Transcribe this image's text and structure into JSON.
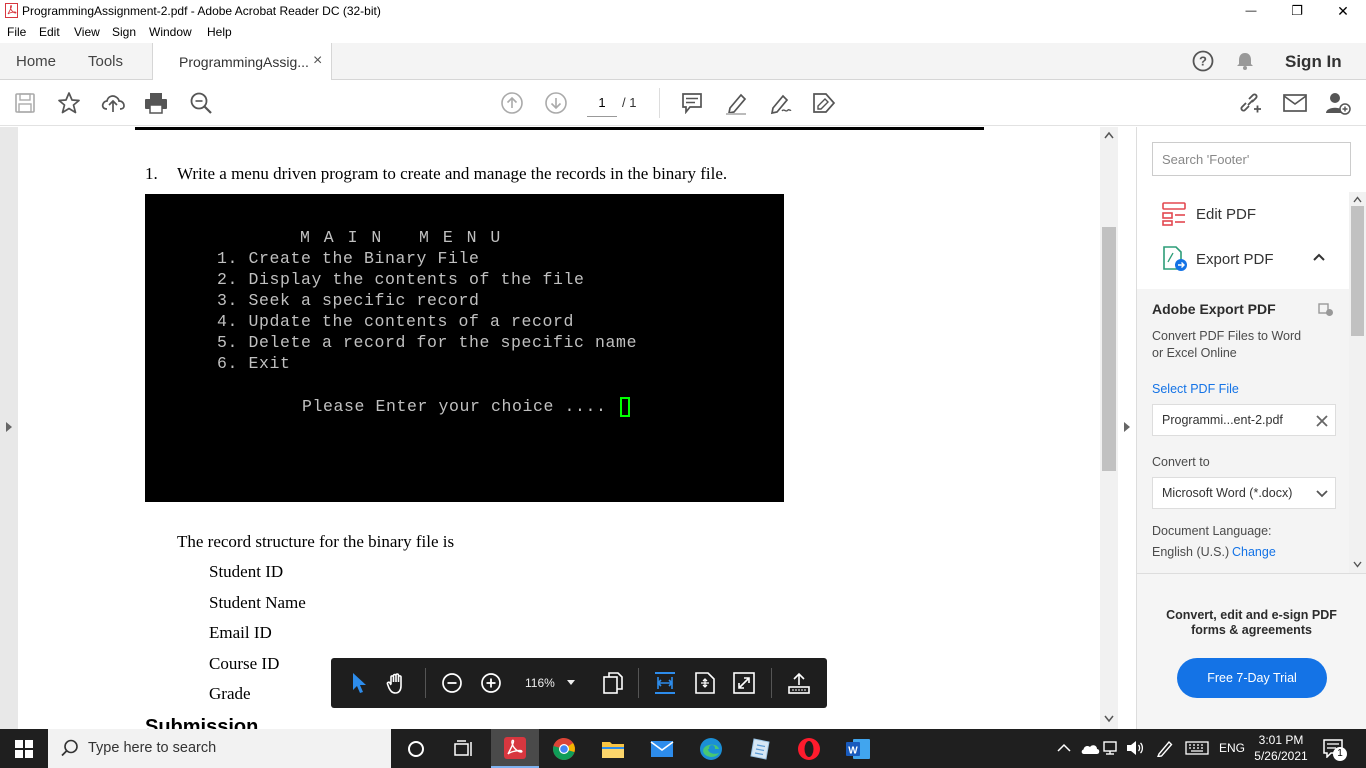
{
  "window": {
    "title": "ProgrammingAssignment-2.pdf - Adobe Acrobat Reader DC (32-bit)",
    "minimize_glyph": "—",
    "restore_glyph": "❐",
    "close_glyph": "✕"
  },
  "menu": [
    "File",
    "Edit",
    "View",
    "Sign",
    "Window",
    "Help"
  ],
  "tabs": {
    "home": "Home",
    "tools": "Tools",
    "document": "ProgrammingAssig...",
    "close_glyph": "×",
    "sign_in": "Sign In"
  },
  "toolbar": {
    "page_current": "1",
    "page_total": "/ 1"
  },
  "document": {
    "question_number": "1.",
    "question_text": "Write a menu driven program to create and manage the records in the binary file.",
    "terminal": {
      "title": "M A I N   M E N U",
      "items": [
        "1. Create the Binary File",
        "2. Display the contents of the file",
        "3. Seek a specific record",
        "4. Update the contents of a record",
        "5. Delete a record for the specific name",
        "6. Exit"
      ],
      "prompt": "Please Enter your choice ...."
    },
    "record_intro": "The record structure for the binary file is",
    "record_fields": [
      "Student ID",
      "Student Name",
      "Email ID",
      "Course ID",
      "Grade"
    ],
    "next_heading": "Submission"
  },
  "float_toolbar": {
    "zoom": "116%"
  },
  "right_panel": {
    "search_placeholder": "Search 'Footer'",
    "edit_pdf": "Edit PDF",
    "export_pdf": "Export PDF",
    "export_heading": "Adobe Export PDF",
    "export_desc_line1": "Convert PDF Files to Word",
    "export_desc_line2": "or Excel Online",
    "select_file": "Select PDF File",
    "file_name": "Programmi...ent-2.pdf",
    "convert_to": "Convert to",
    "convert_option": "Microsoft Word (*.docx)",
    "doc_language_label": "Document Language:",
    "doc_language_value": "English (U.S.)",
    "change_link": "Change",
    "promo_line1": "Convert, edit and e-sign PDF",
    "promo_line2": "forms & agreements",
    "trial_button": "Free 7-Day Trial"
  },
  "taskbar": {
    "search_placeholder": "Type here to search",
    "language": "ENG",
    "time": "3:01 PM",
    "date": "5/26/2021",
    "notification_count": "1"
  },
  "colors": {
    "adobe_red": "#d7373f",
    "link_blue": "#1473e6",
    "trial_blue": "#1473e6",
    "cursor_green": "#00ff00",
    "terminal_bg": "#000000",
    "taskbar_bg": "#1f1f1f"
  }
}
